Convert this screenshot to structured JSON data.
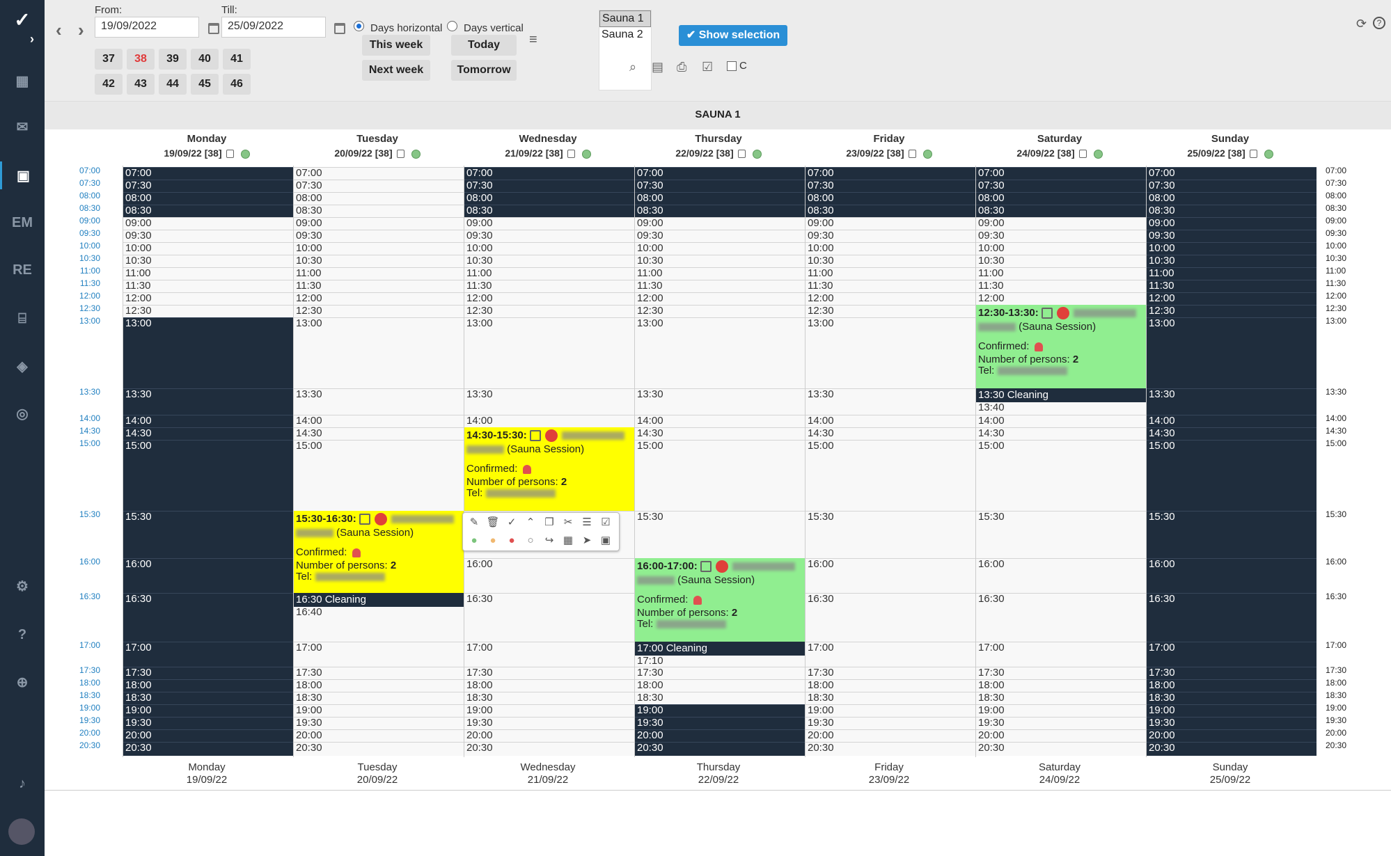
{
  "app": {
    "logo": "logo"
  },
  "sidebar": {
    "items": [
      {
        "name": "expand",
        "label": "›"
      },
      {
        "name": "dashboard",
        "label": "▦"
      },
      {
        "name": "messages",
        "label": "✉"
      },
      {
        "name": "calendar",
        "label": "▣"
      },
      {
        "name": "em",
        "label": "EM"
      },
      {
        "name": "re",
        "label": "RE"
      },
      {
        "name": "register",
        "label": "⌸"
      },
      {
        "name": "box",
        "label": "◈"
      },
      {
        "name": "coins",
        "label": "◎"
      },
      {
        "name": "settings",
        "label": "⚙"
      },
      {
        "name": "help",
        "label": "?"
      },
      {
        "name": "globe",
        "label": "⊕"
      },
      {
        "name": "bell",
        "label": "♪"
      }
    ]
  },
  "header": {
    "from_label": "From:",
    "from_value": "19/09/2022",
    "till_label": "Till:",
    "till_value": "25/09/2022",
    "weeks_row1": [
      "37",
      "38",
      "39",
      "40",
      "41"
    ],
    "weeks_row2": [
      "42",
      "43",
      "44",
      "45",
      "46"
    ],
    "current_week": "38",
    "days_horizontal": "Days horizontal",
    "days_vertical": "Days vertical",
    "this_week": "This week",
    "today": "Today",
    "next_week": "Next week",
    "tomorrow": "Tomorrow",
    "resources": [
      "Sauna 1",
      "Sauna 2"
    ],
    "selected_resource": "Sauna 1",
    "show_selection": "Show selection",
    "c_label": "C"
  },
  "resource_title": "SAUNA 1",
  "days": [
    {
      "name": "Monday",
      "date": "19/09/22 [38]",
      "foot": "19/09/22"
    },
    {
      "name": "Tuesday",
      "date": "20/09/22 [38]",
      "foot": "20/09/22"
    },
    {
      "name": "Wednesday",
      "date": "21/09/22 [38]",
      "foot": "21/09/22"
    },
    {
      "name": "Thursday",
      "date": "22/09/22 [38]",
      "foot": "22/09/22"
    },
    {
      "name": "Friday",
      "date": "23/09/22 [38]",
      "foot": "23/09/22"
    },
    {
      "name": "Saturday",
      "date": "24/09/22 [38]",
      "foot": "24/09/22"
    },
    {
      "name": "Sunday",
      "date": "25/09/22 [38]",
      "foot": "25/09/22"
    }
  ],
  "times": [
    "07:00",
    "07:30",
    "08:00",
    "08:30",
    "09:00",
    "09:30",
    "10:00",
    "10:30",
    "11:00",
    "11:30",
    "12:00",
    "12:30",
    "13:00",
    "13:30",
    "14:00",
    "14:30",
    "15:00",
    "15:30",
    "16:00",
    "16:30",
    "17:00",
    "17:30",
    "18:00",
    "18:30",
    "19:00",
    "19:30",
    "20:00",
    "20:30"
  ],
  "events": {
    "sat": {
      "time": "12:30-13:30:",
      "type": "(Sauna Session)",
      "confirmed": "Confirmed:",
      "persons_label": "Number of persons:",
      "persons": "2",
      "tel": "Tel:",
      "cleaning": "13:30 Cleaning",
      "after": "13:40"
    },
    "wed": {
      "time": "14:30-15:30:",
      "type": "(Sauna Session)",
      "confirmed": "Confirmed:",
      "persons_label": "Number of persons:",
      "persons": "2",
      "tel": "Tel:"
    },
    "tue": {
      "time": "15:30-16:30:",
      "type": "(Sauna Session)",
      "confirmed": "Confirmed:",
      "persons_label": "Number of persons:",
      "persons": "2",
      "tel": "Tel:",
      "cleaning": "16:30 Cleaning",
      "after": "16:40"
    },
    "thu": {
      "time": "16:00-17:00:",
      "type": "(Sauna Session)",
      "confirmed": "Confirmed:",
      "persons_label": "Number of persons:",
      "persons": "2",
      "tel": "Tel:",
      "cleaning": "17:00 Cleaning",
      "after": "17:10"
    }
  },
  "colors": {
    "dark": "#1f2d3d",
    "yellow": "#ffff00",
    "green": "#90ee90",
    "accent": "#2a8fd6"
  }
}
